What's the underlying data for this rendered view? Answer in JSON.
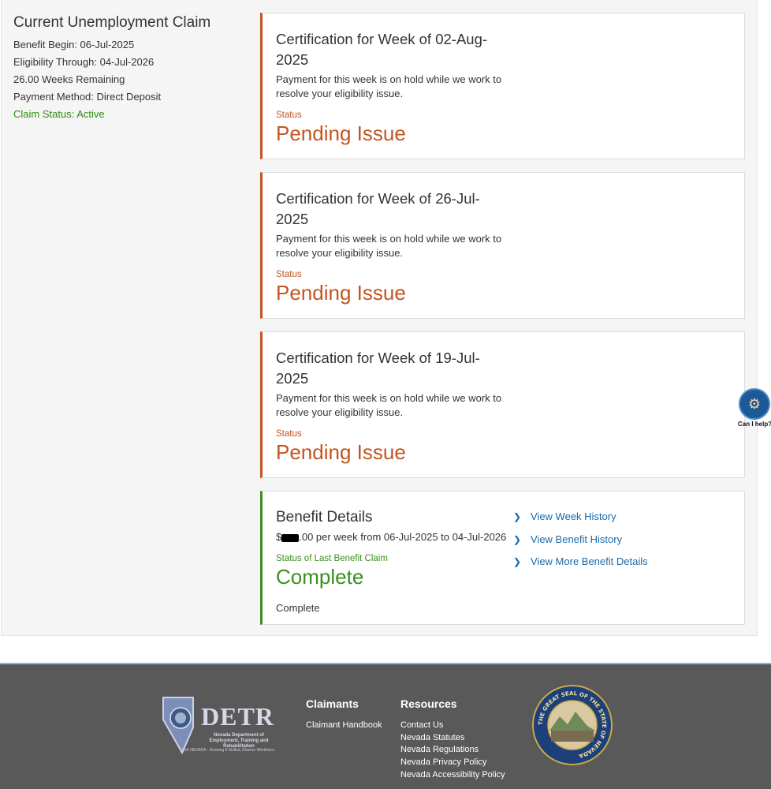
{
  "claim": {
    "title": "Current Unemployment Claim",
    "benefit_begin": "Benefit Begin: 06-Jul-2025",
    "eligibility": "Eligibility Through: 04-Jul-2026",
    "weeks_remaining": "26.00 Weeks Remaining",
    "payment_method": "Payment Method: Direct Deposit",
    "claim_status": "Claim Status: Active"
  },
  "certifications": [
    {
      "title": "Certification for Week of 02-Aug-2025",
      "description": "Payment for this week is on hold while we work to resolve your eligibility issue.",
      "status_label": "Status",
      "status_value": "Pending Issue"
    },
    {
      "title": "Certification for Week of 26-Jul-2025",
      "description": "Payment for this week is on hold while we work to resolve your eligibility issue.",
      "status_label": "Status",
      "status_value": "Pending Issue"
    },
    {
      "title": "Certification for Week of 19-Jul-2025",
      "description": "Payment for this week is on hold while we work to resolve your eligibility issue.",
      "status_label": "Status",
      "status_value": "Pending Issue"
    }
  ],
  "benefit": {
    "title": "Benefit Details",
    "amount_prefix": "$",
    "amount_suffix": ".00 per week from 06-Jul-2025 to 04-Jul-2026",
    "status_label": "Status of Last Benefit Claim",
    "status_value": "Complete",
    "status_detail": "Complete",
    "links": [
      "View Week History",
      "View Benefit History",
      "View More Benefit Details"
    ]
  },
  "help": {
    "label": "Can I help?"
  },
  "footer": {
    "logo_text": "DETR",
    "logo_subtitle": "Nevada Department of Employment, Training and Rehabilitation",
    "logo_tagline": "ONE NEVADA - Growing A Skilled, Diverse Workforce",
    "claimants_heading": "Claimants",
    "claimants_links": [
      "Claimant Handbook"
    ],
    "resources_heading": "Resources",
    "resources_links": [
      "Contact Us",
      "Nevada Statutes",
      "Nevada Regulations",
      "Nevada Privacy Policy",
      "Nevada Accessibility Policy"
    ],
    "seal_text": "THE GREAT SEAL OF THE STATE OF NEVADA"
  },
  "colors": {
    "pending": "#c2551f",
    "complete": "#3b8f1f",
    "link": "#1a6aa6",
    "footer_bg": "#595959"
  }
}
